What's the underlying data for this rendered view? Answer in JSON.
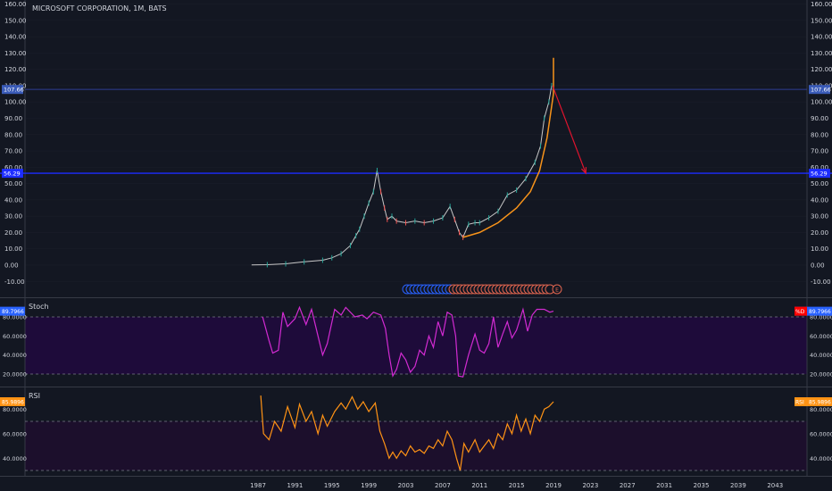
{
  "title": "MICROSOFT CORPORATION, 1M, BATS",
  "colors": {
    "background": "#131722",
    "grid": "#2a2e39",
    "axis_text": "#d1d4dc",
    "price": "#c8c8c8",
    "price_line": "#2f3e94",
    "support_line": "#1d2dff",
    "arc": "#f7931a",
    "arrow": "#e0142e",
    "stoch": "#d22bd2",
    "stoch_band": "#1e0b3a",
    "rsi": "#ff9315",
    "rsi_band": "#1c0f2c",
    "badge_blue": "#2962ff",
    "badge_red": "#ff0000",
    "badge_orange": "#ff9315"
  },
  "chart_data": [
    {
      "pane": "price",
      "type": "candlestick",
      "title": "MICROSOFT CORPORATION, 1M, BATS",
      "xlim": [
        1985.0,
        2048.0
      ],
      "ylim": [
        -15,
        160
      ],
      "y_ticks": [
        "-10.00",
        "0.00",
        "10.00",
        "20.00",
        "30.00",
        "40.00",
        "50.00",
        "60.00",
        "70.00",
        "80.00",
        "90.00",
        "100.00",
        "110.00",
        "120.00",
        "130.00",
        "140.00",
        "150.00",
        "160.00"
      ],
      "x_ticks": [
        "1987",
        "1991",
        "1995",
        "1999",
        "2003",
        "2007",
        "2011",
        "2015",
        "2019",
        "2023",
        "2027",
        "2031",
        "2035",
        "2039",
        "2043"
      ],
      "series": [
        {
          "values_xy": [
            [
              1986.3,
              0.1
            ],
            [
              1988,
              0.3
            ],
            [
              1990,
              0.8
            ],
            [
              1992,
              2.0
            ],
            [
              1994,
              3.0
            ],
            [
              1995,
              4.5
            ],
            [
              1996,
              7
            ],
            [
              1997,
              12
            ],
            [
              1997.6,
              18
            ],
            [
              1998,
              22
            ],
            [
              1998.5,
              30
            ],
            [
              1999,
              38
            ],
            [
              1999.5,
              45
            ],
            [
              1999.9,
              58
            ],
            [
              2000.3,
              45
            ],
            [
              2000.7,
              35
            ],
            [
              2001,
              28
            ],
            [
              2001.5,
              30
            ],
            [
              2002,
              27
            ],
            [
              2003,
              26
            ],
            [
              2004,
              27
            ],
            [
              2005,
              26
            ],
            [
              2006,
              27
            ],
            [
              2007,
              29
            ],
            [
              2007.8,
              36
            ],
            [
              2008.3,
              28
            ],
            [
              2008.8,
              20
            ],
            [
              2009.2,
              17
            ],
            [
              2009.8,
              25
            ],
            [
              2010.5,
              26
            ],
            [
              2011,
              26
            ],
            [
              2012,
              29
            ],
            [
              2013,
              33
            ],
            [
              2014,
              43
            ],
            [
              2015,
              46
            ],
            [
              2016,
              53
            ],
            [
              2017,
              63
            ],
            [
              2017.6,
              73
            ],
            [
              2018,
              90
            ],
            [
              2018.5,
              100
            ],
            [
              2018.8,
              110
            ]
          ]
        }
      ],
      "horizontal_lines": [
        {
          "label": "107.66",
          "value": 107.66
        },
        {
          "label": "56.29",
          "value": 56.29
        }
      ],
      "arc_points": [
        [
          2009.2,
          17
        ],
        [
          2011,
          20
        ],
        [
          2013,
          26
        ],
        [
          2015,
          35
        ],
        [
          2016.5,
          45
        ],
        [
          2017.5,
          58
        ],
        [
          2018.3,
          78
        ],
        [
          2019.0,
          105
        ],
        [
          2019.0,
          127
        ]
      ],
      "arrow": {
        "from": [
          2018.9,
          110
        ],
        "to": [
          2022.5,
          56.29
        ]
      },
      "events": {
        "blue_count": 13,
        "red_count": 28,
        "last_label": "E"
      }
    },
    {
      "pane": "stoch",
      "type": "line",
      "label": "Stoch",
      "ylim": [
        10,
        92
      ],
      "y_ticks": [
        "20.0000",
        "40.0000",
        "60.0000",
        "80.0000"
      ],
      "band": [
        20,
        80
      ],
      "last_value_label": "89.7966",
      "badge_label": "%D",
      "series": [
        {
          "values_xy": [
            [
              1987.5,
              80
            ],
            [
              1988.2,
              55
            ],
            [
              1988.6,
              42
            ],
            [
              1989.2,
              45
            ],
            [
              1989.7,
              85
            ],
            [
              1990.2,
              70
            ],
            [
              1991,
              78
            ],
            [
              1991.5,
              90
            ],
            [
              1992.2,
              72
            ],
            [
              1992.8,
              88
            ],
            [
              1993.5,
              60
            ],
            [
              1994,
              40
            ],
            [
              1994.5,
              52
            ],
            [
              1995.3,
              88
            ],
            [
              1996,
              82
            ],
            [
              1996.5,
              90
            ],
            [
              1997.5,
              80
            ],
            [
              1998.3,
              82
            ],
            [
              1998.8,
              78
            ],
            [
              1999.5,
              85
            ],
            [
              2000.3,
              82
            ],
            [
              2000.8,
              68
            ],
            [
              2001.2,
              40
            ],
            [
              2001.6,
              18
            ],
            [
              2002,
              25
            ],
            [
              2002.5,
              42
            ],
            [
              2003,
              35
            ],
            [
              2003.5,
              22
            ],
            [
              2004,
              28
            ],
            [
              2004.5,
              45
            ],
            [
              2005,
              40
            ],
            [
              2005.5,
              60
            ],
            [
              2006,
              48
            ],
            [
              2006.5,
              75
            ],
            [
              2007,
              60
            ],
            [
              2007.5,
              85
            ],
            [
              2008,
              82
            ],
            [
              2008.4,
              60
            ],
            [
              2008.7,
              18
            ],
            [
              2009.2,
              17
            ],
            [
              2009.8,
              40
            ],
            [
              2010.5,
              62
            ],
            [
              2011,
              45
            ],
            [
              2011.5,
              42
            ],
            [
              2012,
              52
            ],
            [
              2012.5,
              80
            ],
            [
              2013,
              48
            ],
            [
              2013.5,
              62
            ],
            [
              2014,
              75
            ],
            [
              2014.5,
              58
            ],
            [
              2015,
              66
            ],
            [
              2015.7,
              88
            ],
            [
              2016.2,
              65
            ],
            [
              2016.7,
              82
            ],
            [
              2017.2,
              88
            ],
            [
              2018,
              88
            ],
            [
              2018.6,
              85
            ],
            [
              2019,
              86
            ]
          ]
        }
      ]
    },
    {
      "pane": "rsi",
      "type": "line",
      "label": "RSI",
      "ylim": [
        27,
        93
      ],
      "y_ticks": [
        "40.0000",
        "60.0000",
        "80.0000"
      ],
      "band": [
        30,
        70
      ],
      "last_value_label": "85.9896",
      "badge_label": "RSI",
      "series": [
        {
          "values_xy": [
            [
              1987.3,
              91
            ],
            [
              1987.6,
              60
            ],
            [
              1988.2,
              55
            ],
            [
              1988.8,
              70
            ],
            [
              1989.5,
              62
            ],
            [
              1990.2,
              82
            ],
            [
              1991,
              65
            ],
            [
              1991.5,
              84
            ],
            [
              1992.2,
              70
            ],
            [
              1992.8,
              78
            ],
            [
              1993.5,
              60
            ],
            [
              1994,
              75
            ],
            [
              1994.5,
              66
            ],
            [
              1995.3,
              78
            ],
            [
              1996,
              85
            ],
            [
              1996.5,
              80
            ],
            [
              1997.2,
              90
            ],
            [
              1997.8,
              80
            ],
            [
              1998.4,
              86
            ],
            [
              1999,
              78
            ],
            [
              1999.7,
              85
            ],
            [
              2000.2,
              62
            ],
            [
              2000.7,
              52
            ],
            [
              2001.2,
              40
            ],
            [
              2001.6,
              45
            ],
            [
              2002,
              40
            ],
            [
              2002.5,
              46
            ],
            [
              2003,
              42
            ],
            [
              2003.5,
              50
            ],
            [
              2004,
              45
            ],
            [
              2004.5,
              47
            ],
            [
              2005,
              44
            ],
            [
              2005.5,
              50
            ],
            [
              2006,
              48
            ],
            [
              2006.5,
              55
            ],
            [
              2007,
              50
            ],
            [
              2007.5,
              62
            ],
            [
              2008,
              55
            ],
            [
              2008.5,
              40
            ],
            [
              2008.9,
              30
            ],
            [
              2009.3,
              52
            ],
            [
              2009.8,
              45
            ],
            [
              2010.5,
              55
            ],
            [
              2011,
              45
            ],
            [
              2011.5,
              50
            ],
            [
              2012,
              55
            ],
            [
              2012.5,
              48
            ],
            [
              2013,
              60
            ],
            [
              2013.5,
              55
            ],
            [
              2014,
              68
            ],
            [
              2014.5,
              60
            ],
            [
              2015,
              75
            ],
            [
              2015.5,
              62
            ],
            [
              2016,
              72
            ],
            [
              2016.5,
              60
            ],
            [
              2017,
              75
            ],
            [
              2017.5,
              70
            ],
            [
              2018,
              80
            ],
            [
              2018.5,
              82
            ],
            [
              2019,
              86
            ]
          ]
        }
      ]
    }
  ]
}
